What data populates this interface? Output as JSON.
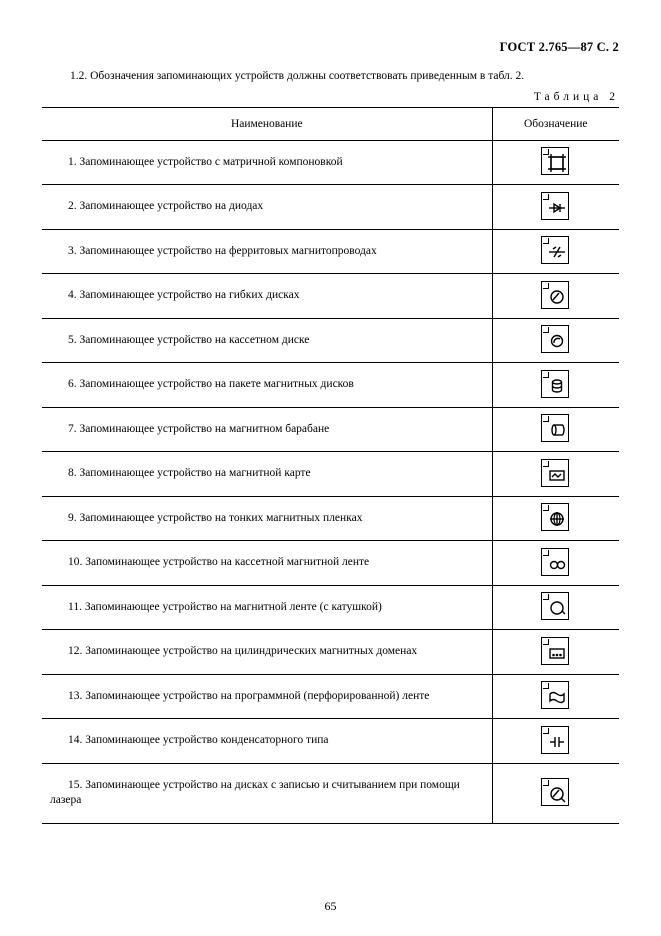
{
  "header": "ГОСТ 2.765—87 С. 2",
  "intro": "1.2. Обозначения запоминающих устройств должны соответствовать приведенным в табл. 2.",
  "table_caption": "Таблица 2",
  "col_name": "Наименование",
  "col_symbol": "Обозначение",
  "rows": [
    {
      "text": "1. Запоминающее устройство с матричной компоновкой",
      "icon": "matrix"
    },
    {
      "text": "2. Запоминающее устройство на диодах",
      "icon": "diode"
    },
    {
      "text": "3. Запоминающее устройство на ферритовых магнитопроводах",
      "icon": "ferrite"
    },
    {
      "text": "4. Запоминающее устройство на гибких дисках",
      "icon": "floppy"
    },
    {
      "text": "5. Запоминающее устройство на кассетном диске",
      "icon": "cassette-disk"
    },
    {
      "text": "6. Запоминающее устройство на пакете магнитных дисков",
      "icon": "disk-pack"
    },
    {
      "text": "7. Запоминающее устройство на магнитном барабане",
      "icon": "drum"
    },
    {
      "text": "8. Запоминающее устройство на магнитной карте",
      "icon": "mag-card"
    },
    {
      "text": "9. Запоминающее устройство на тонких магнитных пленках",
      "icon": "thin-film"
    },
    {
      "text": "10. Запоминающее устройство на кассетной магнитной ленте",
      "icon": "cassette-tape"
    },
    {
      "text": "11. Запоминающее устройство на магнитной ленте (с катушкой)",
      "icon": "reel"
    },
    {
      "text": "12. Запоминающее устройство на цилиндрических магнитных доменах",
      "icon": "bubble"
    },
    {
      "text": "13. Запоминающее устройство на программной (перфорированной) ленте",
      "icon": "punched-tape"
    },
    {
      "text": "14. Запоминающее устройство конденсаторного типа",
      "icon": "capacitor"
    },
    {
      "text": "15. Запоминающее устройство на дисках с записью и считыванием при помощи лазера",
      "icon": "laser-disk"
    }
  ],
  "page_number": "65"
}
